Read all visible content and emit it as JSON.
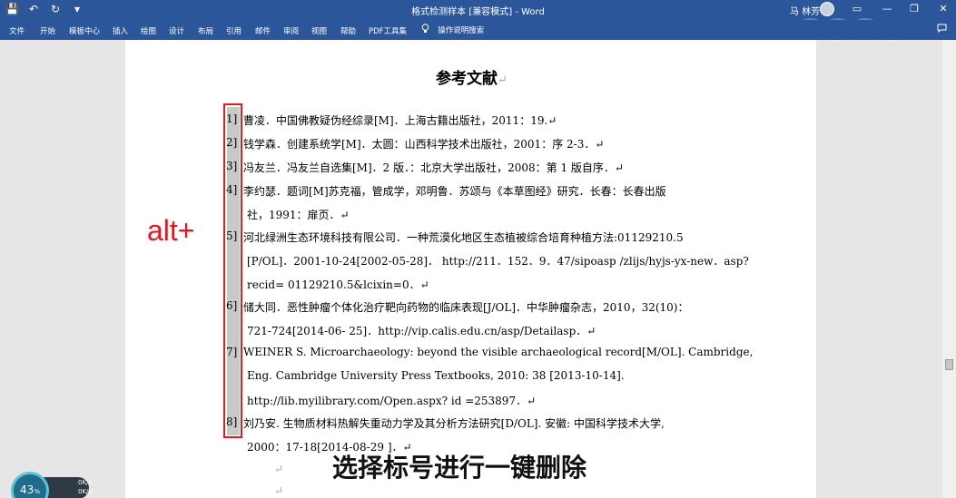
{
  "titlebar": {
    "title": "格式检测样本 [兼容模式] - Word",
    "user": "马 林芳",
    "qat": [
      "💾",
      "↶",
      "↻",
      "▾"
    ],
    "controls": [
      "▭",
      "—",
      "❐",
      "✕"
    ]
  },
  "ribbon": {
    "tabs": [
      "文件",
      "开始",
      "模板中心",
      "插入",
      "绘图",
      "设计",
      "布局",
      "引用",
      "邮件",
      "审阅",
      "视图",
      "帮助",
      "PDF工具集"
    ],
    "tell_me_icon": "lightbulb-icon",
    "tell_me": "操作说明搜索",
    "comment_icon": "comment-icon"
  },
  "document": {
    "title": "参考文献",
    "paragraph_mark": "↵",
    "numbers": [
      "1]",
      "2]",
      "3]",
      "4]",
      "5]",
      "6]",
      "7]",
      "8]"
    ],
    "lines": [
      "曹凌．中国佛教疑伪经综录[M]．上海古籍出版社，2011：19.↵",
      "钱学森．创建系统学[M]．太圆：山西科学技术出版社，2001：序 2-3．↵",
      "冯友兰．冯友兰自选集[M]．2 版．：北京大学出版社，2008：第 1 版自序．↵",
      "李约瑟．题词[M]苏克福，管成学，邓明鲁．苏颂与《本草图经》研究．长春：长春出版",
      "社，1991：扉页．↵",
      "河北绿洲生态环境科技有限公司．一种荒漠化地区生态植被综合培育种植方法:01129210.5",
      "[P/OL]．2001-10-24[2002-05-28]．  http://211．152．9．47/sipoasp /zlijs/hyjs-yx-new．asp?",
      "recid= 01129210.5&lcixin=0．↵",
      "储大同．恶性肿瘤个体化治疗靶向药物的临床表现[J/OL]．中华肿瘤杂志，2010，32(10)：",
      "721-724[2014-06- 25]．http://vip.calis.edu.cn/asp/Detailasp．↵",
      "WEINER S. Microarchaeology: beyond the visible archaeological record[M/OL]. Cambridge,",
      "Eng. Cambridge University Press Textbooks, 2010: 38 [2013-10-14].",
      "http://lib.myilibrary.com/Open.aspx? id =253897．↵",
      "刘乃安. 生物质材料热解失重动力学及其分析方法研究[D/OL]. 安徽: 中国科学技术大学,",
      "2000：17-18[2014-08-29 ]．↵",
      "↵",
      "↵"
    ]
  },
  "overlay": {
    "shortcut": "alt+",
    "caption": "选择标号进行一键删除"
  },
  "perf_widget": {
    "percent": "43",
    "percent_unit": "%",
    "rate_up": "0K/s",
    "rate_down": "0K/s"
  }
}
